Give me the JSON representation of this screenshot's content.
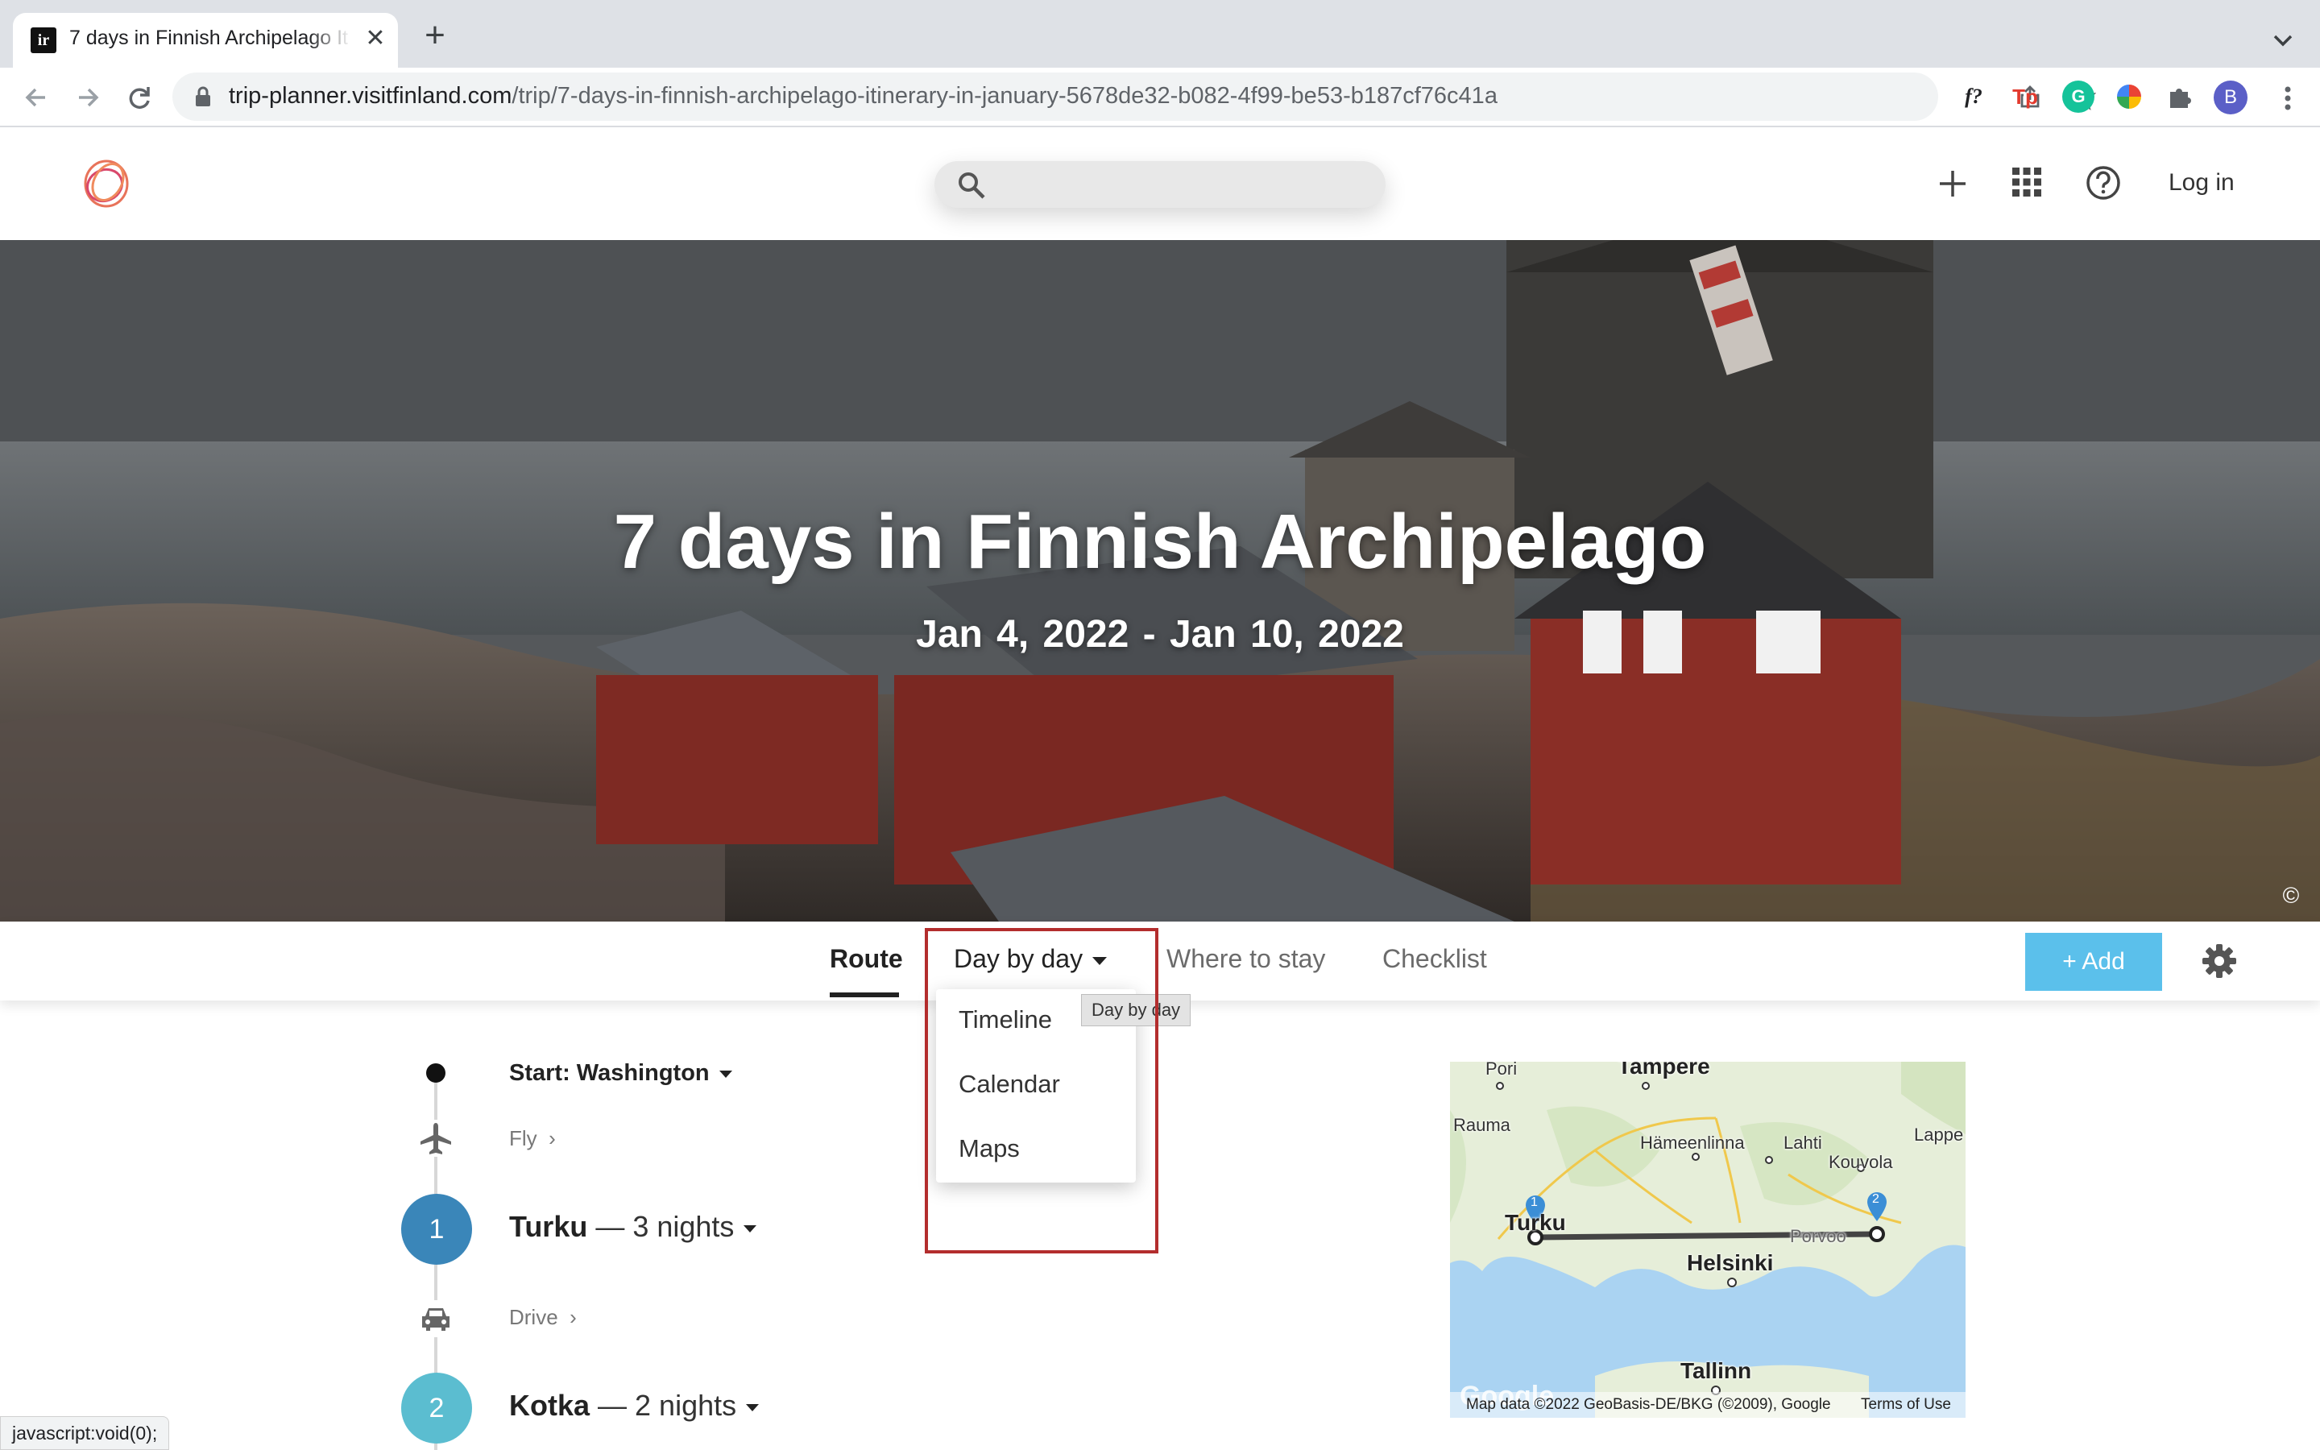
{
  "browser": {
    "tab_title": "7 days in Finnish Archipelago It",
    "tab_close": "✕",
    "new_tab": "+",
    "url_host": "trip-planner.visitfinland.com",
    "url_path": "/trip/7-days-in-finnish-archipelago-itinerary-in-january-5678de32-b082-4f99-be53-b187cf76c41a",
    "favicon_text": "ir",
    "profile_initial": "B",
    "ext_f": "f?",
    "ext_tp": "Tp",
    "ext_g": "G",
    "status_text": "javascript:void(0);",
    "icons": [
      "back-icon",
      "forward-icon",
      "reload-icon",
      "lock-icon",
      "share-icon",
      "star-icon",
      "puzzle-icon",
      "kebab-icon"
    ]
  },
  "header": {
    "search_placeholder": "",
    "login_label": "Log in",
    "icons": [
      "logo-icon",
      "search-icon",
      "plus-icon",
      "apps-grid-icon",
      "help-icon"
    ]
  },
  "hero": {
    "title": "7 days in Finnish Archipelago",
    "dates": "Jan 4, 2022  -  Jan 10, 2022",
    "credit": "©"
  },
  "tabs": {
    "route": "Route",
    "day_by_day": "Day by day",
    "where_to_stay": "Where to stay",
    "checklist": "Checklist",
    "add_label": "+ Add"
  },
  "dropdown": {
    "items": [
      "Timeline",
      "Calendar",
      "Maps"
    ],
    "tooltip": "Day by day"
  },
  "route": {
    "start_label": "Start: Washington",
    "fly_label": "Fly",
    "drive_label": "Drive",
    "stops": [
      {
        "number": "1",
        "city": "Turku",
        "nights": " — 3 nights"
      },
      {
        "number": "2",
        "city": "Kotka",
        "nights": " — 2 nights"
      }
    ]
  },
  "map": {
    "labels": {
      "pori": "Pori",
      "tampere": "Tampere",
      "rauma": "Rauma",
      "hameenlinna": "Hämeenlinna",
      "lahti": "Lahti",
      "lappe": "Lappe",
      "kouvola": "Kouvola",
      "turku": "Turku",
      "porvoo": "Porvoo",
      "helsinki": "Helsinki",
      "tallinn": "Tallinn"
    },
    "marker_1": "1",
    "marker_2": "2",
    "data_text": "Map data ©2022 GeoBasis-DE/BKG (©2009), Google",
    "terms": "Terms of Use",
    "google": "Google",
    "colors": {
      "water": "#aad3f2",
      "land": "#e8eedc",
      "route": "#444444",
      "marker": "#3b8ed6"
    }
  }
}
